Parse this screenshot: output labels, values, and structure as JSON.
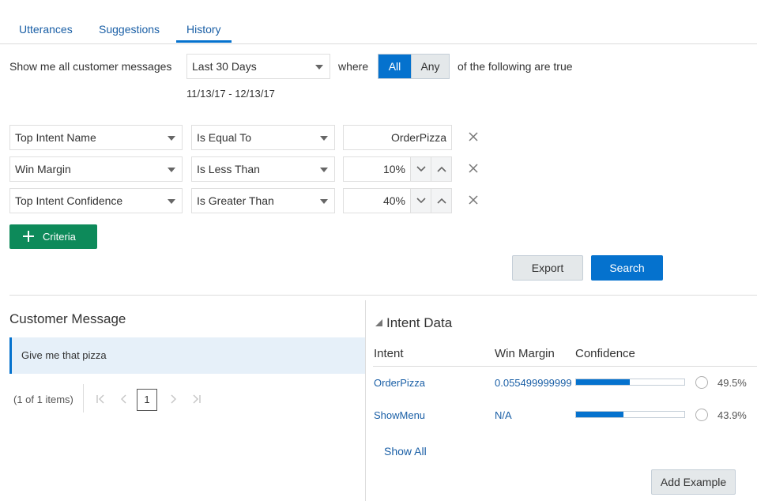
{
  "tabs": [
    {
      "label": "Utterances"
    },
    {
      "label": "Suggestions"
    },
    {
      "label": "History",
      "active": true
    }
  ],
  "filter": {
    "prefix": "Show me all customer messages",
    "range_selected": "Last 30 Days",
    "where_label": "where",
    "all_label": "All",
    "any_label": "Any",
    "all_selected": true,
    "suffix": "of the following are true",
    "date_range": "11/13/17 - 12/13/17"
  },
  "criteria": [
    {
      "field": "Top Intent Name",
      "operator": "Is Equal To",
      "value": "OrderPizza",
      "has_spinner": false
    },
    {
      "field": "Win Margin",
      "operator": "Is Less Than",
      "value": "10%",
      "has_spinner": true
    },
    {
      "field": "Top Intent Confidence",
      "operator": "Is Greater Than",
      "value": "40%",
      "has_spinner": true
    }
  ],
  "buttons": {
    "criteria_label": "Criteria",
    "export_label": "Export",
    "search_label": "Search",
    "show_all_label": "Show All",
    "add_example_label": "Add Example"
  },
  "customer_panel": {
    "title": "Customer Message",
    "messages": [
      "Give me that pizza"
    ],
    "pager_info": "(1 of 1 items)",
    "current_page": "1"
  },
  "intent_panel": {
    "title": "Intent Data",
    "columns": [
      "Intent",
      "Win Margin",
      "Confidence"
    ],
    "rows": [
      {
        "intent": "OrderPizza",
        "win_margin": "0.055499999999",
        "confidence_pct": "49.5%",
        "confidence": 0.495
      },
      {
        "intent": "ShowMenu",
        "win_margin": "N/A",
        "confidence_pct": "43.9%",
        "confidence": 0.439
      }
    ]
  },
  "colors": {
    "accent": "#0572ce",
    "criteria_button": "#0d8a5a",
    "link": "#1a5fa6"
  }
}
